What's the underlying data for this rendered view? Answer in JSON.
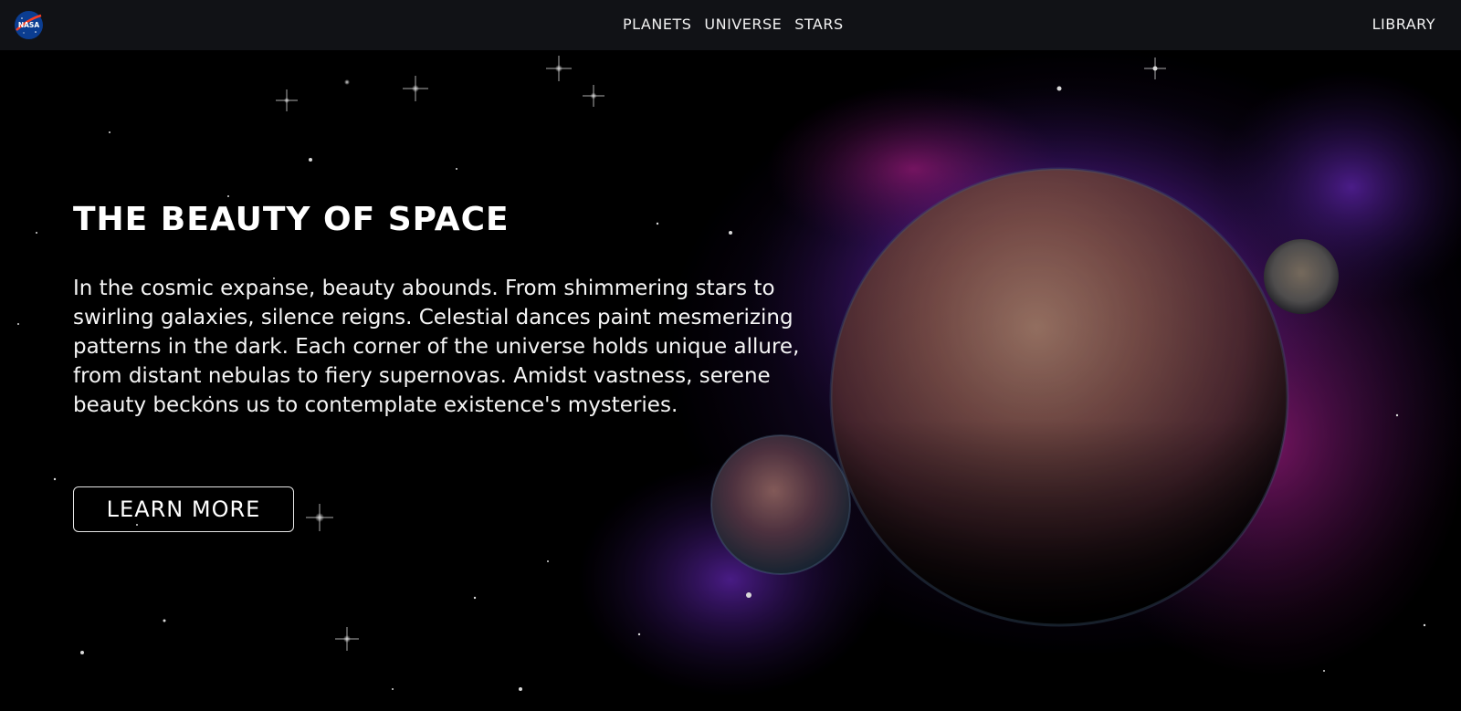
{
  "nav": {
    "logo_text": "NASA",
    "links": [
      "PLANETS",
      "UNIVERSE",
      "STARS"
    ],
    "right_link": "LIBRARY"
  },
  "hero": {
    "title": "THE BEAUTY OF SPACE",
    "description": "In the cosmic expanse, beauty abounds. From shimmering stars to swirling galaxies, silence reigns. Celestial dances paint mesmerizing patterns in the dark. Each corner of the universe holds unique allure, from distant nebulas to fiery supernovas. Amidst vastness, serene beauty beckons us to contemplate existence's mysteries.",
    "button_label": "LEARN MORE"
  },
  "colors": {
    "nav_bg": "#111216",
    "hero_bg": "#000000",
    "nebula_purple": "#7a2bd0",
    "nebula_magenta": "#c21ea8",
    "planet_main": "#7a4a4a"
  }
}
